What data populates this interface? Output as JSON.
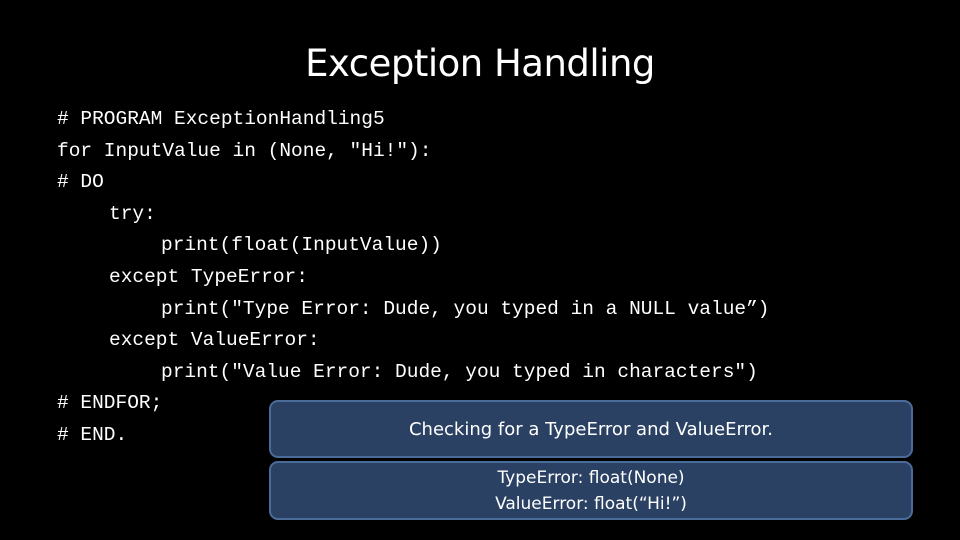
{
  "slide": {
    "title": "Exception Handling",
    "code_lines": [
      {
        "text": "# PROGRAM ExceptionHandling5",
        "indent": 0
      },
      {
        "text": "for InputValue in (None, \"Hi!\"):",
        "indent": 0
      },
      {
        "text": "# DO",
        "indent": 0
      },
      {
        "text": "try:",
        "indent": 1
      },
      {
        "text": "print(float(InputValue))",
        "indent": 2
      },
      {
        "text": "except TypeError:",
        "indent": 1
      },
      {
        "text": "print(\"Type Error: Dude, you typed in a NULL value”)",
        "indent": 2
      },
      {
        "text": "except ValueError:",
        "indent": 1
      },
      {
        "text": "print(\"Value Error: Dude, you typed in characters\")",
        "indent": 2
      },
      {
        "text": "# ENDFOR;",
        "indent": 0
      },
      {
        "text": "# END.",
        "indent": 0
      }
    ],
    "callouts": [
      {
        "lines": [
          "Checking for a TypeError and ValueError."
        ]
      },
      {
        "lines": [
          "TypeError: float(None)",
          "ValueError: float(“Hi!”)"
        ]
      }
    ]
  },
  "colors": {
    "background": "#000000",
    "callout_fill": "#2a4163",
    "callout_border": "#4b6b9a",
    "text": "#ffffff"
  }
}
